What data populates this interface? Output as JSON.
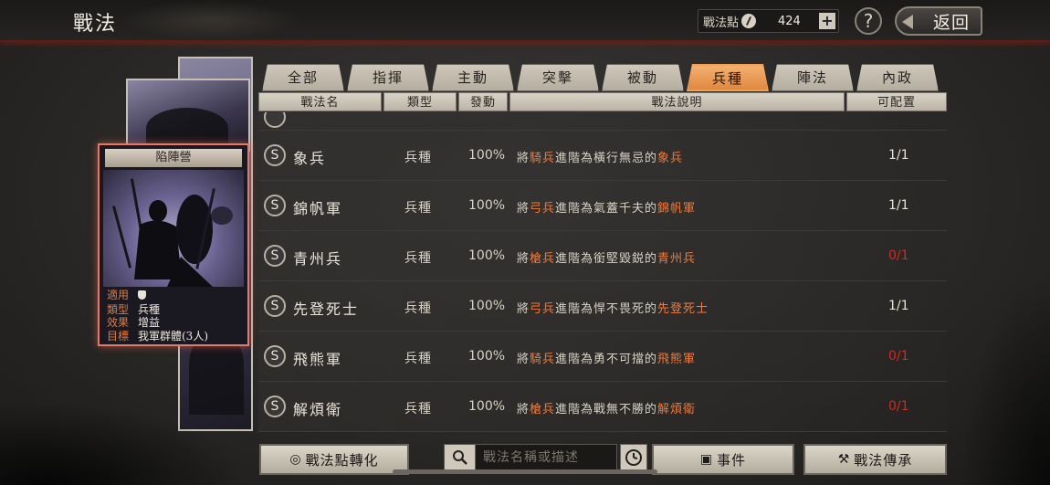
{
  "header": {
    "title": "戰法",
    "points_label": "戰法點",
    "points_value": "424",
    "plus": "+",
    "help": "?",
    "back_label": "返回"
  },
  "card": {
    "title": "陷陣營",
    "rows": [
      {
        "key": "適用",
        "value": ""
      },
      {
        "key": "類型",
        "value": "兵種"
      },
      {
        "key": "效果",
        "value": "增益"
      },
      {
        "key": "目標",
        "value": "我軍群體(3人)"
      }
    ]
  },
  "tabs": [
    {
      "label": "全部"
    },
    {
      "label": "指揮"
    },
    {
      "label": "主動"
    },
    {
      "label": "突擊"
    },
    {
      "label": "被動"
    },
    {
      "label": "兵種",
      "active": true
    },
    {
      "label": "陣法"
    },
    {
      "label": "內政"
    }
  ],
  "columns": [
    "戰法名",
    "類型",
    "發動",
    "戰法說明",
    "可配置"
  ],
  "rows": [
    {
      "badge": "S",
      "name": "象兵",
      "type": "兵種",
      "rate": "100%",
      "desc_pre": "將",
      "desc_hl1": "騎兵",
      "desc_mid": "進階為橫行無忌的",
      "desc_hl2": "象兵",
      "count": "1/1",
      "count_red": false
    },
    {
      "badge": "S",
      "name": "錦帆軍",
      "type": "兵種",
      "rate": "100%",
      "desc_pre": "將",
      "desc_hl1": "弓兵",
      "desc_mid": "進階為氣蓋千夫的",
      "desc_hl2": "錦帆軍",
      "count": "1/1",
      "count_red": false
    },
    {
      "badge": "S",
      "name": "青州兵",
      "type": "兵種",
      "rate": "100%",
      "desc_pre": "將",
      "desc_hl1": "槍兵",
      "desc_mid": "進階為銜堅毀鋭的",
      "desc_hl2": "青州兵",
      "count": "0/1",
      "count_red": true
    },
    {
      "badge": "S",
      "name": "先登死士",
      "type": "兵種",
      "rate": "100%",
      "desc_pre": "將",
      "desc_hl1": "弓兵",
      "desc_mid": "進階為悍不畏死的",
      "desc_hl2": "先登死士",
      "count": "1/1",
      "count_red": false
    },
    {
      "badge": "S",
      "name": "飛熊軍",
      "type": "兵種",
      "rate": "100%",
      "desc_pre": "將",
      "desc_hl1": "騎兵",
      "desc_mid": "進階為勇不可擋的",
      "desc_hl2": "飛熊軍",
      "count": "0/1",
      "count_red": true
    },
    {
      "badge": "S",
      "name": "解煩衛",
      "type": "兵種",
      "rate": "100%",
      "desc_pre": "將",
      "desc_hl1": "槍兵",
      "desc_mid": "進階為戰無不勝的",
      "desc_hl2": "解煩衛",
      "count": "0/1",
      "count_red": true
    }
  ],
  "bottom": {
    "convert_label": "戰法點轉化",
    "search_placeholder": "戰法名稱或描述",
    "events_label": "事件",
    "inherit_label": "戰法傳承"
  },
  "colors": {
    "accent": "#ef7a3a",
    "red": "#d02a22",
    "tab_active": "#e08840"
  }
}
